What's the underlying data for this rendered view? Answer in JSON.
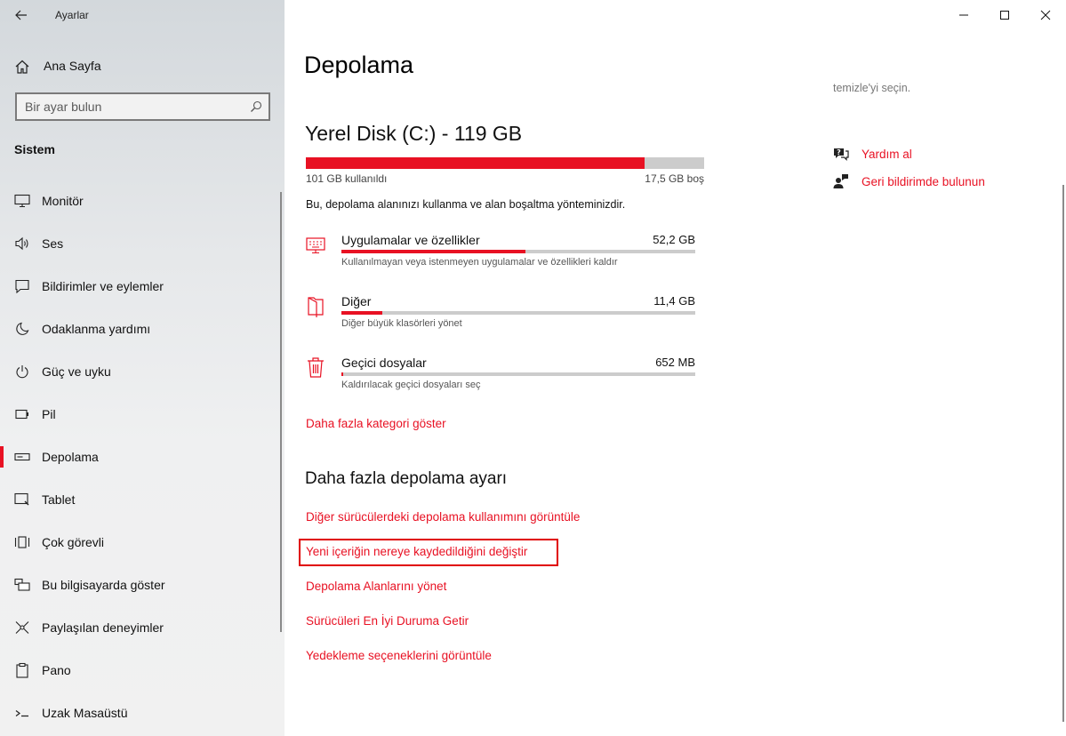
{
  "window": {
    "app_title": "Ayarlar"
  },
  "sidebar": {
    "home_label": "Ana Sayfa",
    "search_placeholder": "Bir ayar bulun",
    "section_title": "Sistem",
    "items": [
      {
        "label": "Monitör",
        "icon": "monitor-icon"
      },
      {
        "label": "Ses",
        "icon": "sound-icon"
      },
      {
        "label": "Bildirimler ve eylemler",
        "icon": "notifications-icon"
      },
      {
        "label": "Odaklanma yardımı",
        "icon": "moon-icon"
      },
      {
        "label": "Güç ve uyku",
        "icon": "power-icon"
      },
      {
        "label": "Pil",
        "icon": "battery-icon"
      },
      {
        "label": "Depolama",
        "icon": "storage-icon",
        "selected": true
      },
      {
        "label": "Tablet",
        "icon": "tablet-icon"
      },
      {
        "label": "Çok görevli",
        "icon": "multitasking-icon"
      },
      {
        "label": "Bu bilgisayarda göster",
        "icon": "projecting-icon"
      },
      {
        "label": "Paylaşılan deneyimler",
        "icon": "shared-experiences-icon"
      },
      {
        "label": "Pano",
        "icon": "clipboard-icon"
      },
      {
        "label": "Uzak Masaüstü",
        "icon": "remote-desktop-icon"
      }
    ]
  },
  "main": {
    "page_title": "Depolama",
    "disk": {
      "title": "Yerel Disk (C:) - 119 GB",
      "used_label": "101 GB kullanıldı",
      "free_label": "17,5 GB boş",
      "used_fraction": 0.85
    },
    "description": "Bu, depolama alanınızı kullanma ve alan boşaltma yönteminizdir.",
    "categories": [
      {
        "name": "Uygulamalar ve özellikler",
        "size": "52,2 GB",
        "sub": "Kullanılmayan veya istenmeyen uygulamalar ve özellikleri kaldır",
        "fraction": 0.52,
        "icon": "apps-icon"
      },
      {
        "name": "Diğer",
        "size": "11,4 GB",
        "sub": "Diğer büyük klasörleri yönet",
        "fraction": 0.115,
        "icon": "other-folder-icon"
      },
      {
        "name": "Geçici dosyalar",
        "size": "652 MB",
        "sub": "Kaldırılacak geçici dosyaları seç",
        "fraction": 0.006,
        "icon": "trash-icon"
      }
    ],
    "more_categories_link": "Daha fazla kategori göster",
    "more_settings_heading": "Daha fazla depolama ayarı",
    "more_settings_links": [
      "Diğer sürücülerdeki depolama kullanımını görüntüle",
      "Yeni içeriğin nereye kaydedildiğini değiştir",
      "Depolama Alanlarını yönet",
      "Sürücüleri En İyi Duruma Getir",
      "Yedekleme seçeneklerini görüntüle"
    ],
    "right_panel": {
      "faded_text": "temizle'yi seçin.",
      "help_label": "Yardım al",
      "feedback_label": "Geri bildirimde bulunun"
    }
  },
  "colors": {
    "accent": "#e81123",
    "highlight_box": "#e00000",
    "bar_bg": "#cccccc"
  }
}
